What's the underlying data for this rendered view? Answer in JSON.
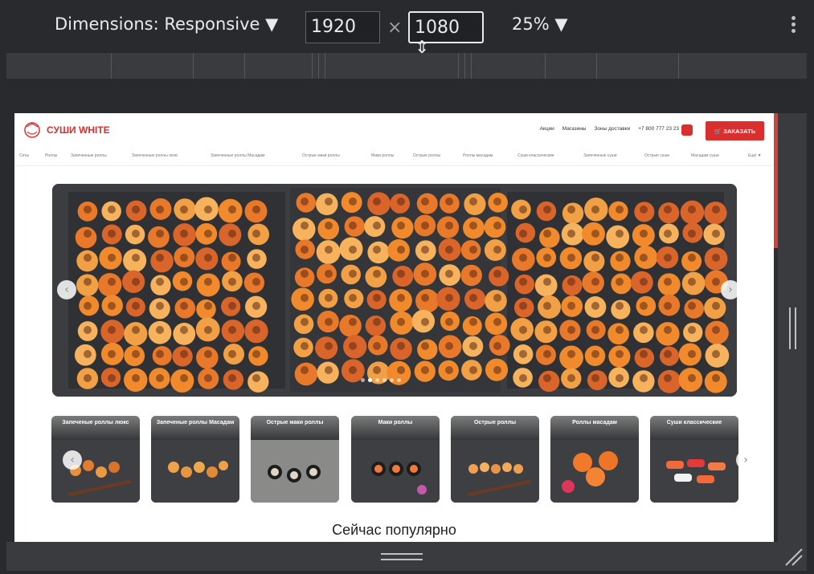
{
  "devtools": {
    "dimensions_label": "Dimensions: Responsive ▼",
    "width_value": "1920",
    "times_sign": "×",
    "height_value": "1080 ⇕",
    "zoom_label": "25% ▼"
  },
  "site": {
    "logo_text": "СУШИ WHITE",
    "nav_links": [
      "Акции",
      "Магазины",
      "Зоны доставки",
      "+7 800 777 23 23"
    ],
    "order_button": "🛒 ЗАКАЗАТЬ",
    "categories": [
      "Сеты",
      "Роллы",
      "Запеченные роллы",
      "Запеченные роллы люкс",
      "Запеченные роллы Масадам",
      "Острые маки роллы",
      "Маки роллы",
      "Острые роллы",
      "Роллы масадам",
      "Суши классические",
      "Запеченные суши",
      "Острые суши",
      "Масадам суши"
    ],
    "more_categories": "Ещё ▼",
    "accent_color": "#d9302f"
  },
  "hero": {
    "prev_arrow": "‹",
    "next_arrow": "›",
    "slide_count": 6,
    "active_slide": 1
  },
  "category_cards": [
    {
      "label": "Запеченые роллы люкс"
    },
    {
      "label": "Запеченые роллы Масадам"
    },
    {
      "label": "Острые маки роллы"
    },
    {
      "label": "Маки роллы"
    },
    {
      "label": "Острые роллы"
    },
    {
      "label": "Роллы масадам"
    },
    {
      "label": "Суши классические"
    }
  ],
  "section_heading": "Сейчас популярно"
}
